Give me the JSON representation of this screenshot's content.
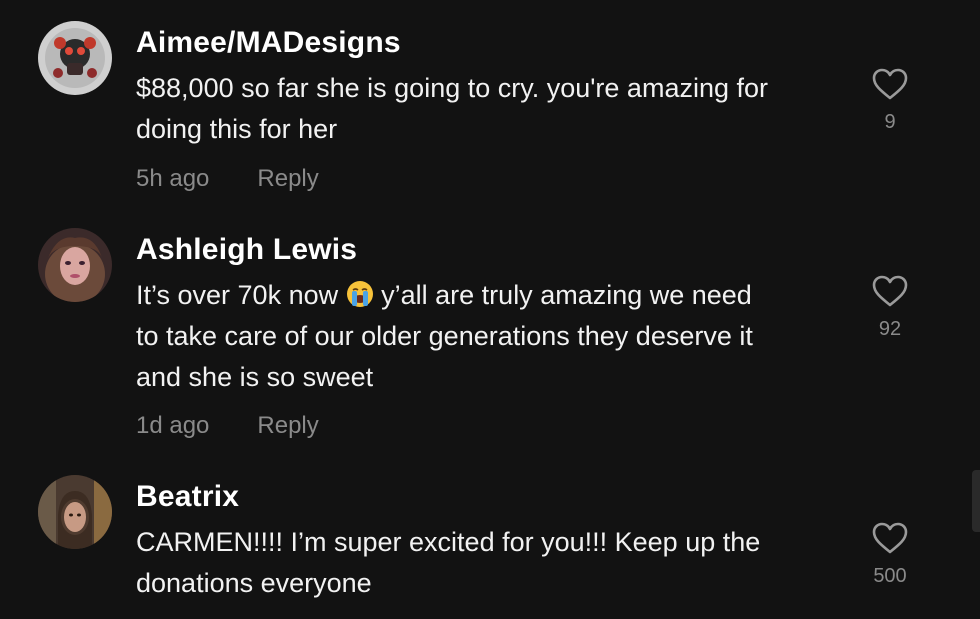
{
  "comments": [
    {
      "username": "Aimee/MADesigns",
      "lines": [
        "$88,000 so far she is going to cry. you're amazing for",
        "doing this for her"
      ],
      "time": "5h ago",
      "reply_label": "Reply",
      "likes": "9",
      "avatar_icon": "avatar-skull-art"
    },
    {
      "username": "Ashleigh Lewis",
      "line1_before": "It’s over 70k now",
      "line1_after": "y’all are truly amazing we need",
      "emoji": "loudly-crying-face-icon",
      "lines_rest": [
        "to take care of our older generations they deserve it",
        "and she is so sweet"
      ],
      "time": "1d ago",
      "reply_label": "Reply",
      "likes": "92",
      "avatar_icon": "avatar-photo-woman"
    },
    {
      "username": "Beatrix",
      "lines": [
        "CARMEN!!!! I’m super excited for you!!! Keep up the",
        "donations everyone"
      ],
      "likes": "500",
      "avatar_icon": "avatar-photo-woman"
    }
  ],
  "colors": {
    "background": "#121212",
    "text": "#ffffff",
    "muted": "#8a8a8a"
  }
}
